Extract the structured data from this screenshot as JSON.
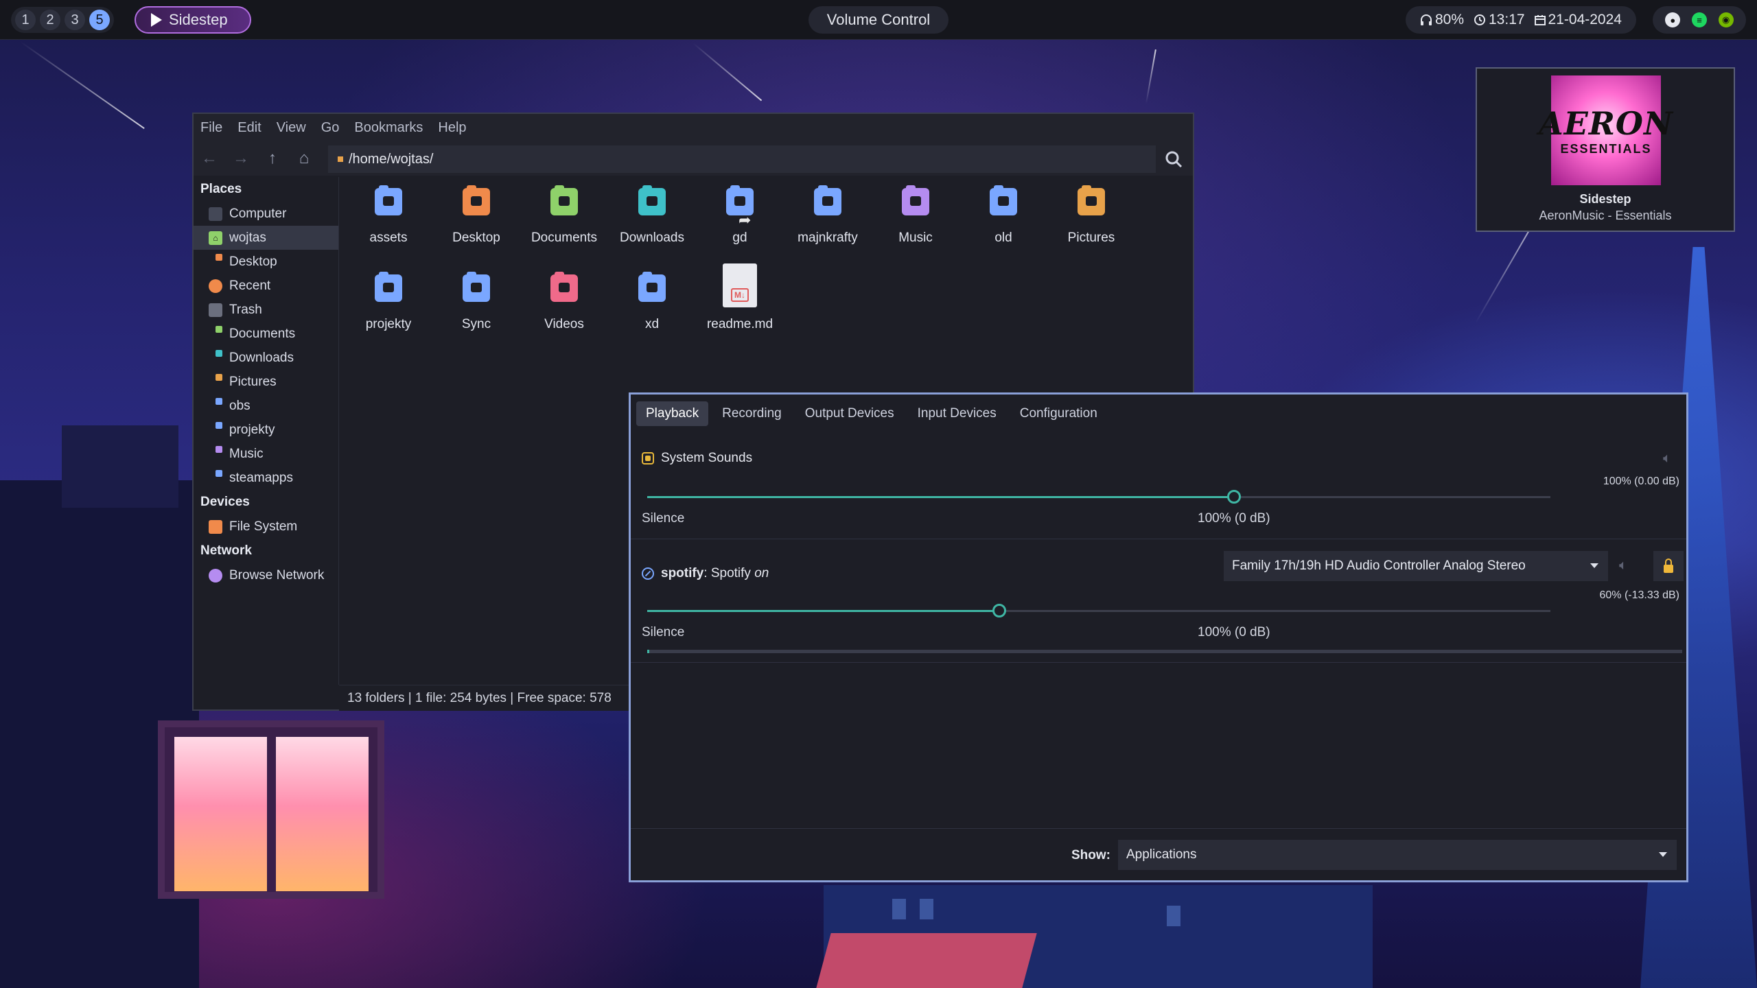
{
  "topbar": {
    "workspaces": [
      "1",
      "2",
      "3",
      "5"
    ],
    "now_playing": "Sidestep",
    "window_title": "Volume Control",
    "status": {
      "volume": "80%",
      "time": "13:17",
      "date": "21-04-2024"
    },
    "tray_icons": [
      "discord-icon",
      "spotify-icon",
      "nvidia-icon"
    ]
  },
  "notification": {
    "title": "Sidestep",
    "body": "AeronMusic - Essentials",
    "art_line1": "AERON",
    "art_line2": "ESSENTIALS"
  },
  "file_manager": {
    "menu": [
      "File",
      "Edit",
      "View",
      "Go",
      "Bookmarks",
      "Help"
    ],
    "path": "/home/wojtas/",
    "sidebar": {
      "places_heading": "Places",
      "places": [
        "Computer",
        "wojtas",
        "Desktop",
        "Recent",
        "Trash",
        "Documents",
        "Downloads",
        "Pictures",
        "obs",
        "projekty",
        "Music",
        "steamapps"
      ],
      "devices_heading": "Devices",
      "devices": [
        "File System"
      ],
      "network_heading": "Network",
      "network": [
        "Browse Network"
      ]
    },
    "files": [
      {
        "name": "assets",
        "color": "#7aa7ff"
      },
      {
        "name": "Desktop",
        "color": "#f08a4b"
      },
      {
        "name": "Documents",
        "color": "#8fd16a"
      },
      {
        "name": "Downloads",
        "color": "#3fc1c9"
      },
      {
        "name": "gd",
        "color": "#7aa7ff"
      },
      {
        "name": "majnkrafty",
        "color": "#7aa7ff"
      },
      {
        "name": "Music",
        "color": "#b58cf0"
      },
      {
        "name": "old",
        "color": "#7aa7ff"
      },
      {
        "name": "Pictures",
        "color": "#e8a24a"
      },
      {
        "name": "projekty",
        "color": "#7aa7ff"
      },
      {
        "name": "Sync",
        "color": "#7aa7ff"
      },
      {
        "name": "Videos",
        "color": "#f06a8a"
      },
      {
        "name": "xd",
        "color": "#7aa7ff"
      },
      {
        "name": "readme.md",
        "color": "#e9eaef"
      }
    ],
    "statusbar": "13 folders  |  1 file: 254 bytes  |  Free space: 578"
  },
  "volume_control": {
    "tabs": [
      "Playback",
      "Recording",
      "Output Devices",
      "Input Devices",
      "Configuration"
    ],
    "active_tab": "Playback",
    "streams": [
      {
        "name": "System Sounds",
        "level_percent": 65,
        "level_label": "100% (0.00 dB)",
        "silence_label": "Silence",
        "ref_label": "100% (0 dB)"
      },
      {
        "app": "spotify",
        "desc": ": Spotify",
        "state": "on",
        "device": "Family 17h/19h HD Audio Controller Analog Stereo",
        "level_percent": 39,
        "level_label": "60% (-13.33 dB)",
        "silence_label": "Silence",
        "ref_label": "100% (0 dB)"
      }
    ],
    "show_label": "Show:",
    "show_value": "Applications"
  },
  "colors": {
    "accent": "#3fb6a4",
    "workspace_active": "#7aa7ff",
    "lock": "#f0b83a"
  }
}
